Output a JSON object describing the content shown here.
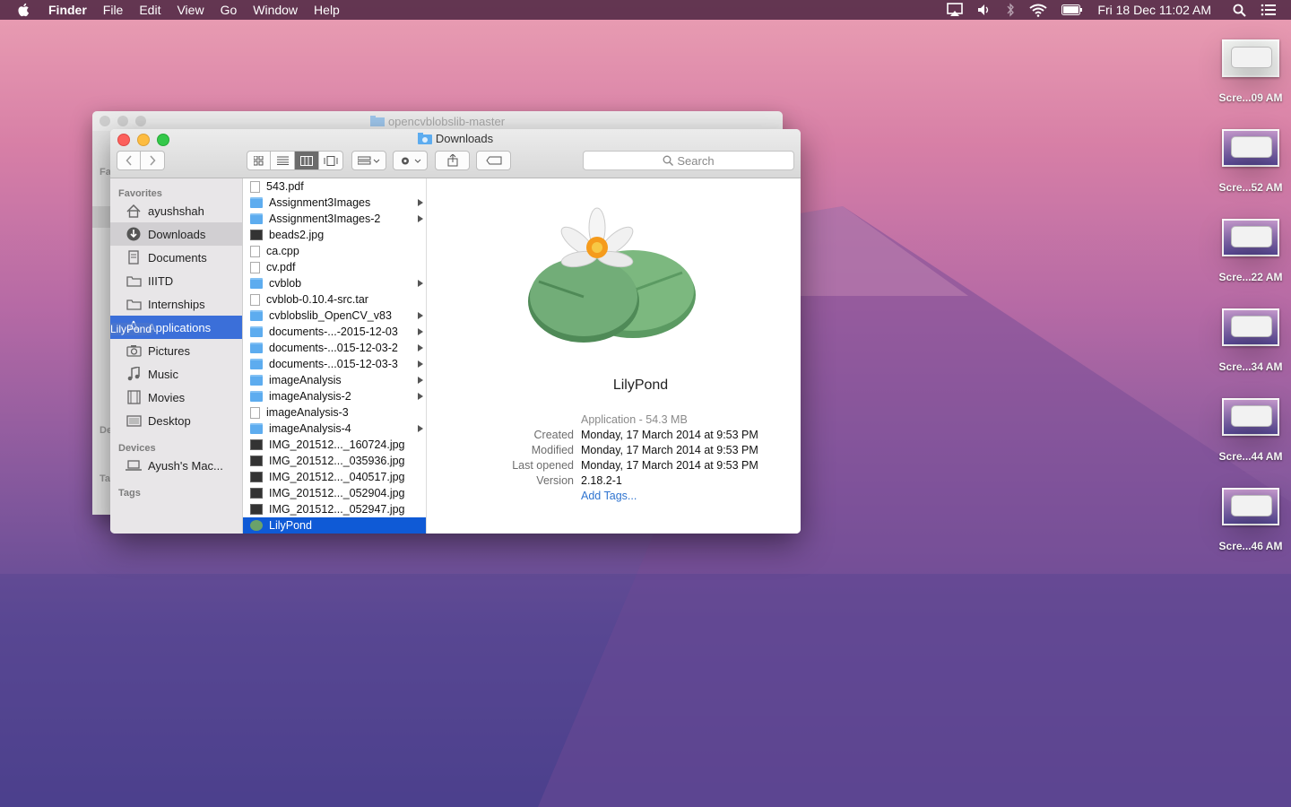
{
  "menubar": {
    "app": "Finder",
    "menus": [
      "File",
      "Edit",
      "View",
      "Go",
      "Window",
      "Help"
    ],
    "clock": "Fri 18 Dec  11:02 AM",
    "status_icons": [
      "airplay-icon",
      "volume-icon",
      "bluetooth-icon",
      "wifi-icon",
      "battery-icon",
      "spotlight-icon",
      "notification-center-icon"
    ]
  },
  "desktop": {
    "screenshots": [
      {
        "label": "Scre...09 AM"
      },
      {
        "label": "Scre...52 AM"
      },
      {
        "label": "Scre...22 AM"
      },
      {
        "label": "Scre...34 AM"
      },
      {
        "label": "Scre...44 AM"
      },
      {
        "label": "Scre...46 AM"
      }
    ]
  },
  "background_window": {
    "title": "opencvblobslib-master",
    "sidebar_fragments": [
      "Fa",
      "De",
      "Ta"
    ]
  },
  "window": {
    "title": "Downloads",
    "search_placeholder": "Search",
    "sidebar": {
      "favorites_heading": "Favorites",
      "favorites": [
        {
          "label": "ayushshah",
          "icon": "home-icon"
        },
        {
          "label": "Downloads",
          "icon": "downloads-icon",
          "selected": true
        },
        {
          "label": "Documents",
          "icon": "documents-icon"
        },
        {
          "label": "IIITD",
          "icon": "folder-icon"
        },
        {
          "label": "Internships",
          "icon": "folder-icon"
        },
        {
          "label": "Applications",
          "icon": "applications-icon",
          "drop_target": true
        },
        {
          "label": "Pictures",
          "icon": "camera-icon"
        },
        {
          "label": "Music",
          "icon": "music-icon"
        },
        {
          "label": "Movies",
          "icon": "film-icon"
        },
        {
          "label": "Desktop",
          "icon": "desktop-icon"
        }
      ],
      "drag_label": "LilyPond",
      "devices_heading": "Devices",
      "devices": [
        {
          "label": "Ayush's Mac...",
          "icon": "laptop-icon"
        }
      ],
      "tags_heading": "Tags"
    },
    "files": [
      {
        "name": "543.pdf",
        "kind": "doc",
        "folder": false
      },
      {
        "name": "Assignment3Images",
        "kind": "folder",
        "folder": true
      },
      {
        "name": "Assignment3Images-2",
        "kind": "folder",
        "folder": true
      },
      {
        "name": "beads2.jpg",
        "kind": "img",
        "folder": false
      },
      {
        "name": "ca.cpp",
        "kind": "doc",
        "folder": false
      },
      {
        "name": "cv.pdf",
        "kind": "doc",
        "folder": false
      },
      {
        "name": "cvblob",
        "kind": "folder",
        "folder": true
      },
      {
        "name": "cvblob-0.10.4-src.tar",
        "kind": "doc",
        "folder": false
      },
      {
        "name": "cvblobslib_OpenCV_v83",
        "kind": "folder",
        "folder": true
      },
      {
        "name": "documents-...-2015-12-03",
        "kind": "folder",
        "folder": true
      },
      {
        "name": "documents-...015-12-03-2",
        "kind": "folder",
        "folder": true
      },
      {
        "name": "documents-...015-12-03-3",
        "kind": "folder",
        "folder": true
      },
      {
        "name": "imageAnalysis",
        "kind": "folder",
        "folder": true
      },
      {
        "name": "imageAnalysis-2",
        "kind": "folder",
        "folder": true
      },
      {
        "name": "imageAnalysis-3",
        "kind": "doc",
        "folder": false
      },
      {
        "name": "imageAnalysis-4",
        "kind": "folder",
        "folder": true
      },
      {
        "name": "IMG_201512..._160724.jpg",
        "kind": "img",
        "folder": false
      },
      {
        "name": "IMG_201512..._035936.jpg",
        "kind": "img",
        "folder": false
      },
      {
        "name": "IMG_201512..._040517.jpg",
        "kind": "img",
        "folder": false
      },
      {
        "name": "IMG_201512..._052904.jpg",
        "kind": "img",
        "folder": false
      },
      {
        "name": "IMG_201512..._052947.jpg",
        "kind": "img",
        "folder": false
      },
      {
        "name": "LilyPond",
        "kind": "app",
        "folder": false,
        "selected": true
      }
    ],
    "preview": {
      "name": "LilyPond",
      "kind_size": "Application - 54.3 MB",
      "created_label": "Created",
      "created": "Monday, 17 March 2014 at 9:53 PM",
      "modified_label": "Modified",
      "modified": "Monday, 17 March 2014 at 9:53 PM",
      "last_opened_label": "Last opened",
      "last_opened": "Monday, 17 March 2014 at 9:53 PM",
      "version_label": "Version",
      "version": "2.18.2-1",
      "add_tags": "Add Tags..."
    }
  }
}
